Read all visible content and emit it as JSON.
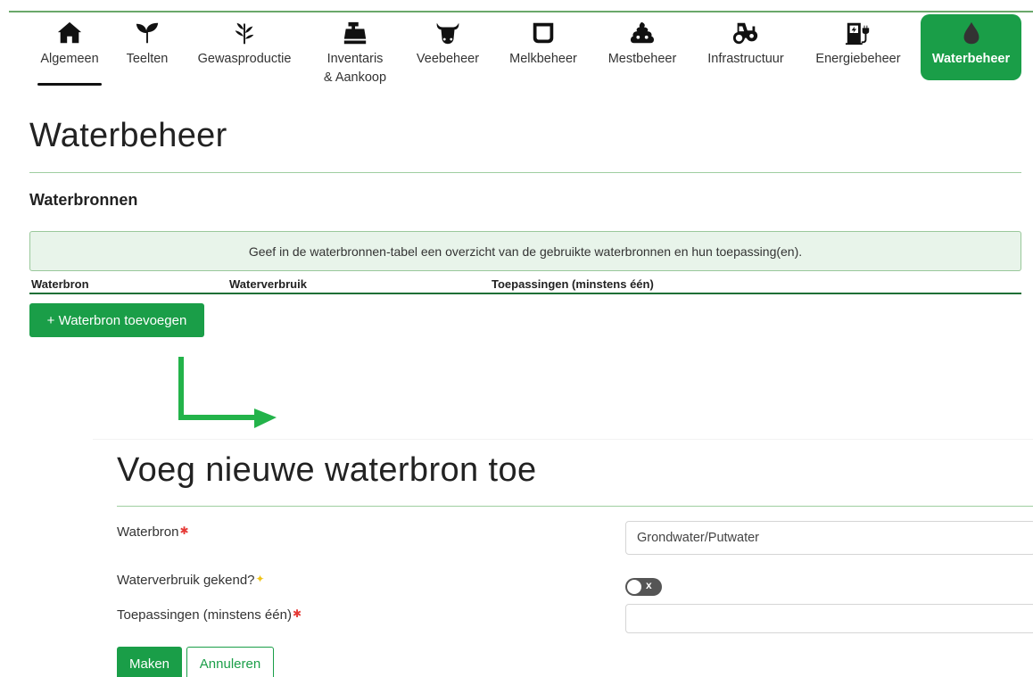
{
  "nav": {
    "items": [
      {
        "label": "Algemeen",
        "icon": "home-icon"
      },
      {
        "label": "Teelten",
        "icon": "sprout-icon"
      },
      {
        "label": "Gewasproductie",
        "icon": "plant-icon"
      },
      {
        "label": "Inventaris",
        "label2": "& Aankoop",
        "icon": "cash-register-icon"
      },
      {
        "label": "Veebeheer",
        "icon": "cow-icon"
      },
      {
        "label": "Melkbeheer",
        "icon": "milk-tank-icon"
      },
      {
        "label": "Mestbeheer",
        "icon": "manure-icon"
      },
      {
        "label": "Infrastructuur",
        "icon": "tractor-icon"
      },
      {
        "label": "Energiebeheer",
        "icon": "charging-station-icon"
      },
      {
        "label": "Waterbeheer",
        "icon": "water-drop-icon"
      }
    ],
    "active": "Waterbeheer",
    "underlined": "Algemeen"
  },
  "page": {
    "title": "Waterbeheer",
    "section_title": "Waterbronnen",
    "info": "Geef in de waterbronnen-tabel een overzicht van de gebruikte waterbronnen en hun toepassing(en).",
    "table_headers": [
      "Waterbron",
      "Waterverbruik",
      "Toepassingen (minstens één)"
    ],
    "add_button": "+ Waterbron toevoegen"
  },
  "form": {
    "title": "Voeg nieuwe waterbron toe",
    "fields": {
      "waterbron_label": "Waterbron",
      "waterbron_value": "Grondwater/Putwater",
      "verbruik_label": "Waterverbruik gekend?",
      "verbruik_toggle": "x",
      "toepassingen_label": "Toepassingen (minstens één)",
      "toepassingen_value": ""
    },
    "required_marker": "✱",
    "optional_marker": "✦",
    "make_button": "Maken",
    "cancel_button": "Annuleren"
  },
  "colors": {
    "accent": "#1a9e48",
    "info_bg": "#e8f4ea",
    "required": "#e53935",
    "optional": "#f0c419"
  }
}
